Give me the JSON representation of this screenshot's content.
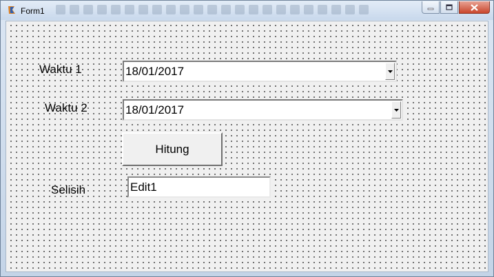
{
  "window": {
    "title": "Form1",
    "icon": "lazarus-app-icon"
  },
  "caption_buttons": [
    "minimize-icon",
    "maximize-icon",
    "close-icon"
  ],
  "form": {
    "waktu1": {
      "label": "Waktu 1",
      "value": "18/01/2017"
    },
    "waktu2": {
      "label": "Waktu 2",
      "value": "18/01/2017"
    },
    "hitung_button": "Hitung",
    "selisih": {
      "label": "Selisih",
      "value": "Edit1"
    }
  }
}
